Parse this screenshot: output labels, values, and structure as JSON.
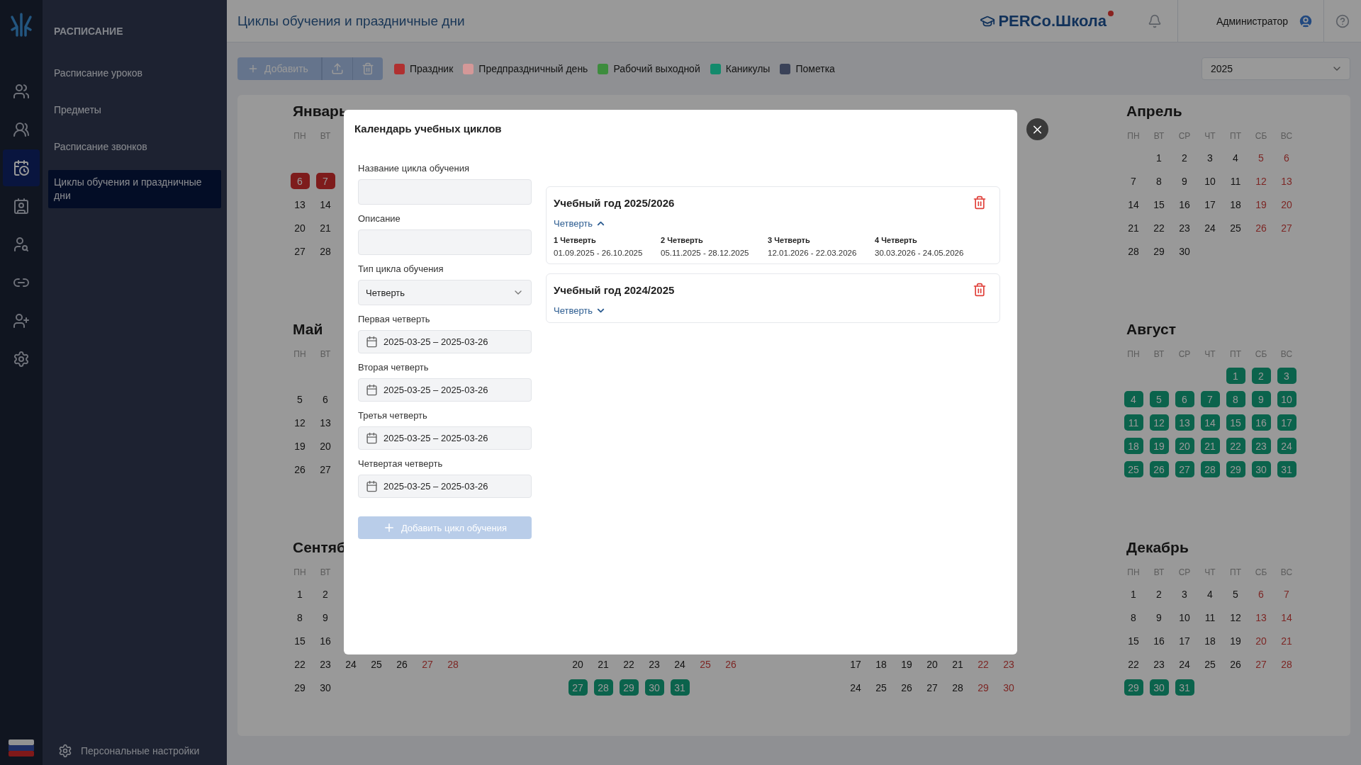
{
  "rail": {
    "items": [
      {
        "kind": "users",
        "selected": false
      },
      {
        "kind": "groups",
        "selected": false
      },
      {
        "kind": "calendar",
        "selected": true
      },
      {
        "kind": "badge",
        "selected": false
      },
      {
        "kind": "user-search",
        "selected": false
      },
      {
        "kind": "link",
        "selected": false
      },
      {
        "kind": "badge-add",
        "selected": false
      },
      {
        "kind": "settings",
        "selected": false
      }
    ]
  },
  "sidebar": {
    "heading": "РАСПИСАНИЕ",
    "items": [
      {
        "label": "Расписание уроков",
        "selected": false
      },
      {
        "label": "Предметы",
        "selected": false
      },
      {
        "label": "Расписание звонков",
        "selected": false
      },
      {
        "label": "Циклы обучения и праздничные дни",
        "selected": true
      }
    ],
    "footer": "Персональные настройки"
  },
  "header": {
    "title": "Циклы обучения и праздничные дни",
    "brand": "PERCo.Школа",
    "user": "Администратор"
  },
  "toolbar": {
    "add_button": "Добавить",
    "legend": [
      {
        "label": "Праздник",
        "color": "#b03030"
      },
      {
        "label": "Предпраздничный день",
        "color": "#d49898"
      },
      {
        "label": "Рабочий выходной",
        "color": "#3d8c3d"
      },
      {
        "label": "Каникулы",
        "color": "#138a6c"
      },
      {
        "label": "Пометка",
        "color": "#3a4258"
      }
    ],
    "year": "2025"
  },
  "calendar": {
    "rows": [
      [
        {
          "title": "Январь",
          "weekdays": [
            "ПН",
            "ВТ"
          ],
          "weeks": [
            [
              {
                "day": "6",
                "kind": "holiday"
              },
              {
                "day": "7",
                "kind": "holiday"
              }
            ],
            [
              {
                "day": "13",
                "kind": "normal"
              },
              {
                "day": "14",
                "kind": "normal"
              }
            ],
            [
              {
                "day": "20",
                "kind": "normal"
              },
              {
                "day": "21",
                "kind": "normal"
              }
            ],
            [
              {
                "day": "27",
                "kind": "normal"
              },
              {
                "day": "28",
                "kind": "normal"
              }
            ]
          ]
        },
        "",
        "",
        {
          "title": "Апрель",
          "weekdays": [
            "ПН",
            "ВТ",
            "СР",
            "ЧТ",
            "ПТ",
            "СБ",
            "ВС"
          ],
          "weeks": [
            [
              {
                "day": "1",
                "kind": "normal"
              },
              {
                "day": "2",
                "kind": "normal"
              },
              {
                "day": "3",
                "kind": "normal"
              },
              {
                "day": "4",
                "kind": "normal"
              },
              {
                "day": "5",
                "kind": "weekend"
              },
              {
                "day": "6",
                "kind": "weekend"
              }
            ],
            [
              {
                "day": "7",
                "kind": "normal"
              },
              {
                "day": "8",
                "kind": "normal"
              },
              {
                "day": "9",
                "kind": "normal"
              },
              {
                "day": "10",
                "kind": "normal"
              },
              {
                "day": "11",
                "kind": "normal"
              },
              {
                "day": "12",
                "kind": "weekend"
              },
              {
                "day": "13",
                "kind": "weekend"
              }
            ],
            [
              {
                "day": "14",
                "kind": "normal"
              },
              {
                "day": "15",
                "kind": "normal"
              },
              {
                "day": "16",
                "kind": "normal"
              },
              {
                "day": "17",
                "kind": "normal"
              },
              {
                "day": "18",
                "kind": "normal"
              },
              {
                "day": "19",
                "kind": "weekend"
              },
              {
                "day": "20",
                "kind": "weekend"
              }
            ],
            [
              {
                "day": "21",
                "kind": "normal"
              },
              {
                "day": "22",
                "kind": "normal"
              },
              {
                "day": "23",
                "kind": "normal"
              },
              {
                "day": "24",
                "kind": "normal"
              },
              {
                "day": "25",
                "kind": "normal"
              },
              {
                "day": "26",
                "kind": "weekend"
              },
              {
                "day": "27",
                "kind": "weekend"
              }
            ],
            [
              {
                "day": "28",
                "kind": "normal"
              },
              {
                "day": "29",
                "kind": "normal"
              },
              {
                "day": "30",
                "kind": "normal"
              }
            ]
          ]
        }
      ],
      [
        {
          "title": "Май",
          "weekdays": [
            "ПН",
            "ВТ"
          ],
          "weeks": [
            [
              {
                "day": "5",
                "kind": "normal"
              },
              {
                "day": "6",
                "kind": "normal"
              }
            ],
            [
              {
                "day": "12",
                "kind": "normal"
              },
              {
                "day": "13",
                "kind": "normal"
              }
            ],
            [
              {
                "day": "19",
                "kind": "normal"
              },
              {
                "day": "20",
                "kind": "normal"
              }
            ],
            [
              {
                "day": "26",
                "kind": "normal"
              },
              {
                "day": "27",
                "kind": "normal"
              }
            ]
          ]
        },
        "",
        "",
        {
          "title": "Август",
          "weekdays": [
            "ПН",
            "ВТ",
            "СР",
            "ЧТ",
            "ПТ",
            "СБ",
            "ВС"
          ],
          "weeks": [
            [
              {
                "day": "1",
                "kind": "vacation"
              },
              {
                "day": "2",
                "kind": "vacation"
              },
              {
                "day": "3",
                "kind": "vacation"
              }
            ],
            [
              {
                "day": "4",
                "kind": "vacation"
              },
              {
                "day": "5",
                "kind": "vacation"
              },
              {
                "day": "6",
                "kind": "vacation"
              },
              {
                "day": "7",
                "kind": "vacation"
              },
              {
                "day": "8",
                "kind": "vacation"
              },
              {
                "day": "9",
                "kind": "vacation"
              },
              {
                "day": "10",
                "kind": "vacation"
              }
            ],
            [
              {
                "day": "11",
                "kind": "vacation"
              },
              {
                "day": "12",
                "kind": "vacation"
              },
              {
                "day": "13",
                "kind": "vacation"
              },
              {
                "day": "14",
                "kind": "vacation"
              },
              {
                "day": "15",
                "kind": "vacation"
              },
              {
                "day": "16",
                "kind": "vacation"
              },
              {
                "day": "17",
                "kind": "vacation"
              }
            ],
            [
              {
                "day": "18",
                "kind": "vacation"
              },
              {
                "day": "19",
                "kind": "vacation"
              },
              {
                "day": "20",
                "kind": "vacation"
              },
              {
                "day": "21",
                "kind": "vacation"
              },
              {
                "day": "22",
                "kind": "vacation"
              },
              {
                "day": "23",
                "kind": "vacation"
              },
              {
                "day": "24",
                "kind": "vacation"
              }
            ],
            [
              {
                "day": "25",
                "kind": "vacation"
              },
              {
                "day": "26",
                "kind": "vacation"
              },
              {
                "day": "27",
                "kind": "vacation"
              },
              {
                "day": "28",
                "kind": "vacation"
              },
              {
                "day": "29",
                "kind": "vacation"
              },
              {
                "day": "30",
                "kind": "vacation"
              },
              {
                "day": "31",
                "kind": "vacation"
              }
            ]
          ]
        }
      ],
      [
        {
          "title": "Сентяб",
          "weekdays": [
            "ПН",
            "ВТ"
          ],
          "weeks": [
            [
              {
                "day": "1",
                "kind": "normal"
              },
              {
                "day": "2",
                "kind": "normal"
              }
            ],
            [
              {
                "day": "8",
                "kind": "normal"
              },
              {
                "day": "9",
                "kind": "normal"
              }
            ],
            [
              {
                "day": "15",
                "kind": "normal"
              },
              {
                "day": "16",
                "kind": "normal"
              }
            ],
            [
              {
                "day": "22",
                "kind": "normal"
              },
              {
                "day": "23",
                "kind": "normal"
              },
              {
                "day": "24",
                "kind": "normal"
              },
              {
                "day": "25",
                "kind": "normal"
              },
              {
                "day": "26",
                "kind": "normal"
              },
              {
                "day": "27",
                "kind": "weekend"
              },
              {
                "day": "28",
                "kind": "weekend"
              }
            ],
            [
              {
                "day": "29",
                "kind": "normal"
              },
              {
                "day": "30",
                "kind": "normal"
              }
            ]
          ]
        },
        {
          "weeks": [
            [
              {
                "day": "20",
                "kind": "normal"
              },
              {
                "day": "21",
                "kind": "normal"
              },
              {
                "day": "22",
                "kind": "normal"
              },
              {
                "day": "23",
                "kind": "normal"
              },
              {
                "day": "24",
                "kind": "normal"
              },
              {
                "day": "25",
                "kind": "weekend"
              },
              {
                "day": "26",
                "kind": "weekend"
              }
            ],
            [
              {
                "day": "27",
                "kind": "vacation"
              },
              {
                "day": "28",
                "kind": "vacation"
              },
              {
                "day": "29",
                "kind": "vacation"
              },
              {
                "day": "30",
                "kind": "vacation"
              },
              {
                "day": "31",
                "kind": "vacation"
              }
            ]
          ]
        },
        {
          "weeks": [
            [
              {
                "day": "17",
                "kind": "normal"
              },
              {
                "day": "18",
                "kind": "normal"
              },
              {
                "day": "19",
                "kind": "normal"
              },
              {
                "day": "20",
                "kind": "normal"
              },
              {
                "day": "21",
                "kind": "normal"
              },
              {
                "day": "22",
                "kind": "weekend"
              },
              {
                "day": "23",
                "kind": "weekend"
              }
            ],
            [
              {
                "day": "24",
                "kind": "normal"
              },
              {
                "day": "25",
                "kind": "normal"
              },
              {
                "day": "26",
                "kind": "normal"
              },
              {
                "day": "27",
                "kind": "normal"
              },
              {
                "day": "28",
                "kind": "normal"
              },
              {
                "day": "29",
                "kind": "weekend"
              },
              {
                "day": "30",
                "kind": "weekend"
              }
            ]
          ]
        },
        {
          "title": "Декабрь",
          "weekdays": [
            "ПН",
            "ВТ",
            "СР",
            "ЧТ",
            "ПТ",
            "СБ",
            "ВС"
          ],
          "weeks": [
            [
              {
                "day": "1",
                "kind": "normal"
              },
              {
                "day": "2",
                "kind": "normal"
              },
              {
                "day": "3",
                "kind": "normal"
              },
              {
                "day": "4",
                "kind": "normal"
              },
              {
                "day": "5",
                "kind": "normal"
              },
              {
                "day": "6",
                "kind": "weekend"
              },
              {
                "day": "7",
                "kind": "weekend"
              }
            ],
            [
              {
                "day": "8",
                "kind": "normal"
              },
              {
                "day": "9",
                "kind": "normal"
              },
              {
                "day": "10",
                "kind": "normal"
              },
              {
                "day": "11",
                "kind": "normal"
              },
              {
                "day": "12",
                "kind": "normal"
              },
              {
                "day": "13",
                "kind": "weekend"
              },
              {
                "day": "14",
                "kind": "weekend"
              }
            ],
            [
              {
                "day": "15",
                "kind": "normal"
              },
              {
                "day": "16",
                "kind": "normal"
              },
              {
                "day": "17",
                "kind": "normal"
              },
              {
                "day": "18",
                "kind": "normal"
              },
              {
                "day": "19",
                "kind": "normal"
              },
              {
                "day": "20",
                "kind": "weekend"
              },
              {
                "day": "21",
                "kind": "weekend"
              }
            ],
            [
              {
                "day": "22",
                "kind": "normal"
              },
              {
                "day": "23",
                "kind": "normal"
              },
              {
                "day": "24",
                "kind": "normal"
              },
              {
                "day": "25",
                "kind": "normal"
              },
              {
                "day": "26",
                "kind": "normal"
              },
              {
                "day": "27",
                "kind": "weekend"
              },
              {
                "day": "28",
                "kind": "weekend"
              }
            ],
            [
              {
                "day": "29",
                "kind": "vacation"
              },
              {
                "day": "30",
                "kind": "vacation"
              },
              {
                "day": "31",
                "kind": "vacation"
              }
            ]
          ]
        }
      ]
    ]
  },
  "modal": {
    "title": "Календарь учебных циклов",
    "fields": [
      {
        "kind": "text",
        "label": "Название цикла обучения"
      },
      {
        "kind": "text",
        "label": "Описание"
      },
      {
        "kind": "select",
        "label": "Тип цикла обучения",
        "value": "Четверть"
      },
      {
        "kind": "date",
        "label": "Первая четверть",
        "value": "2025-03-25 – 2025-03-26"
      },
      {
        "kind": "date",
        "label": "Вторая четверть",
        "value": "2025-03-25 – 2025-03-26"
      },
      {
        "kind": "date",
        "label": "Третья четверть",
        "value": "2025-03-25 – 2025-03-26"
      },
      {
        "kind": "date",
        "label": "Четвертая четверть",
        "value": "2025-03-25 – 2025-03-26"
      }
    ],
    "submit": {
      "label": "Добавить цикл обучения",
      "disabled": true
    },
    "cycles": [
      {
        "title": "Учебный год 2025/2026",
        "toggle": "Четверть",
        "expanded": true,
        "periods": [
          {
            "name": "1 Четверть",
            "range": "01.09.2025 - 26.10.2025"
          },
          {
            "name": "2 Четверть",
            "range": "05.11.2025 - 28.12.2025"
          },
          {
            "name": "3 Четверть",
            "range": "12.01.2026 - 22.03.2026"
          },
          {
            "name": "4 Четверть",
            "range": "30.03.2026 - 24.05.2026"
          }
        ]
      },
      {
        "title": "Учебный год 2024/2025",
        "toggle": "Четверть",
        "expanded": false
      }
    ]
  }
}
